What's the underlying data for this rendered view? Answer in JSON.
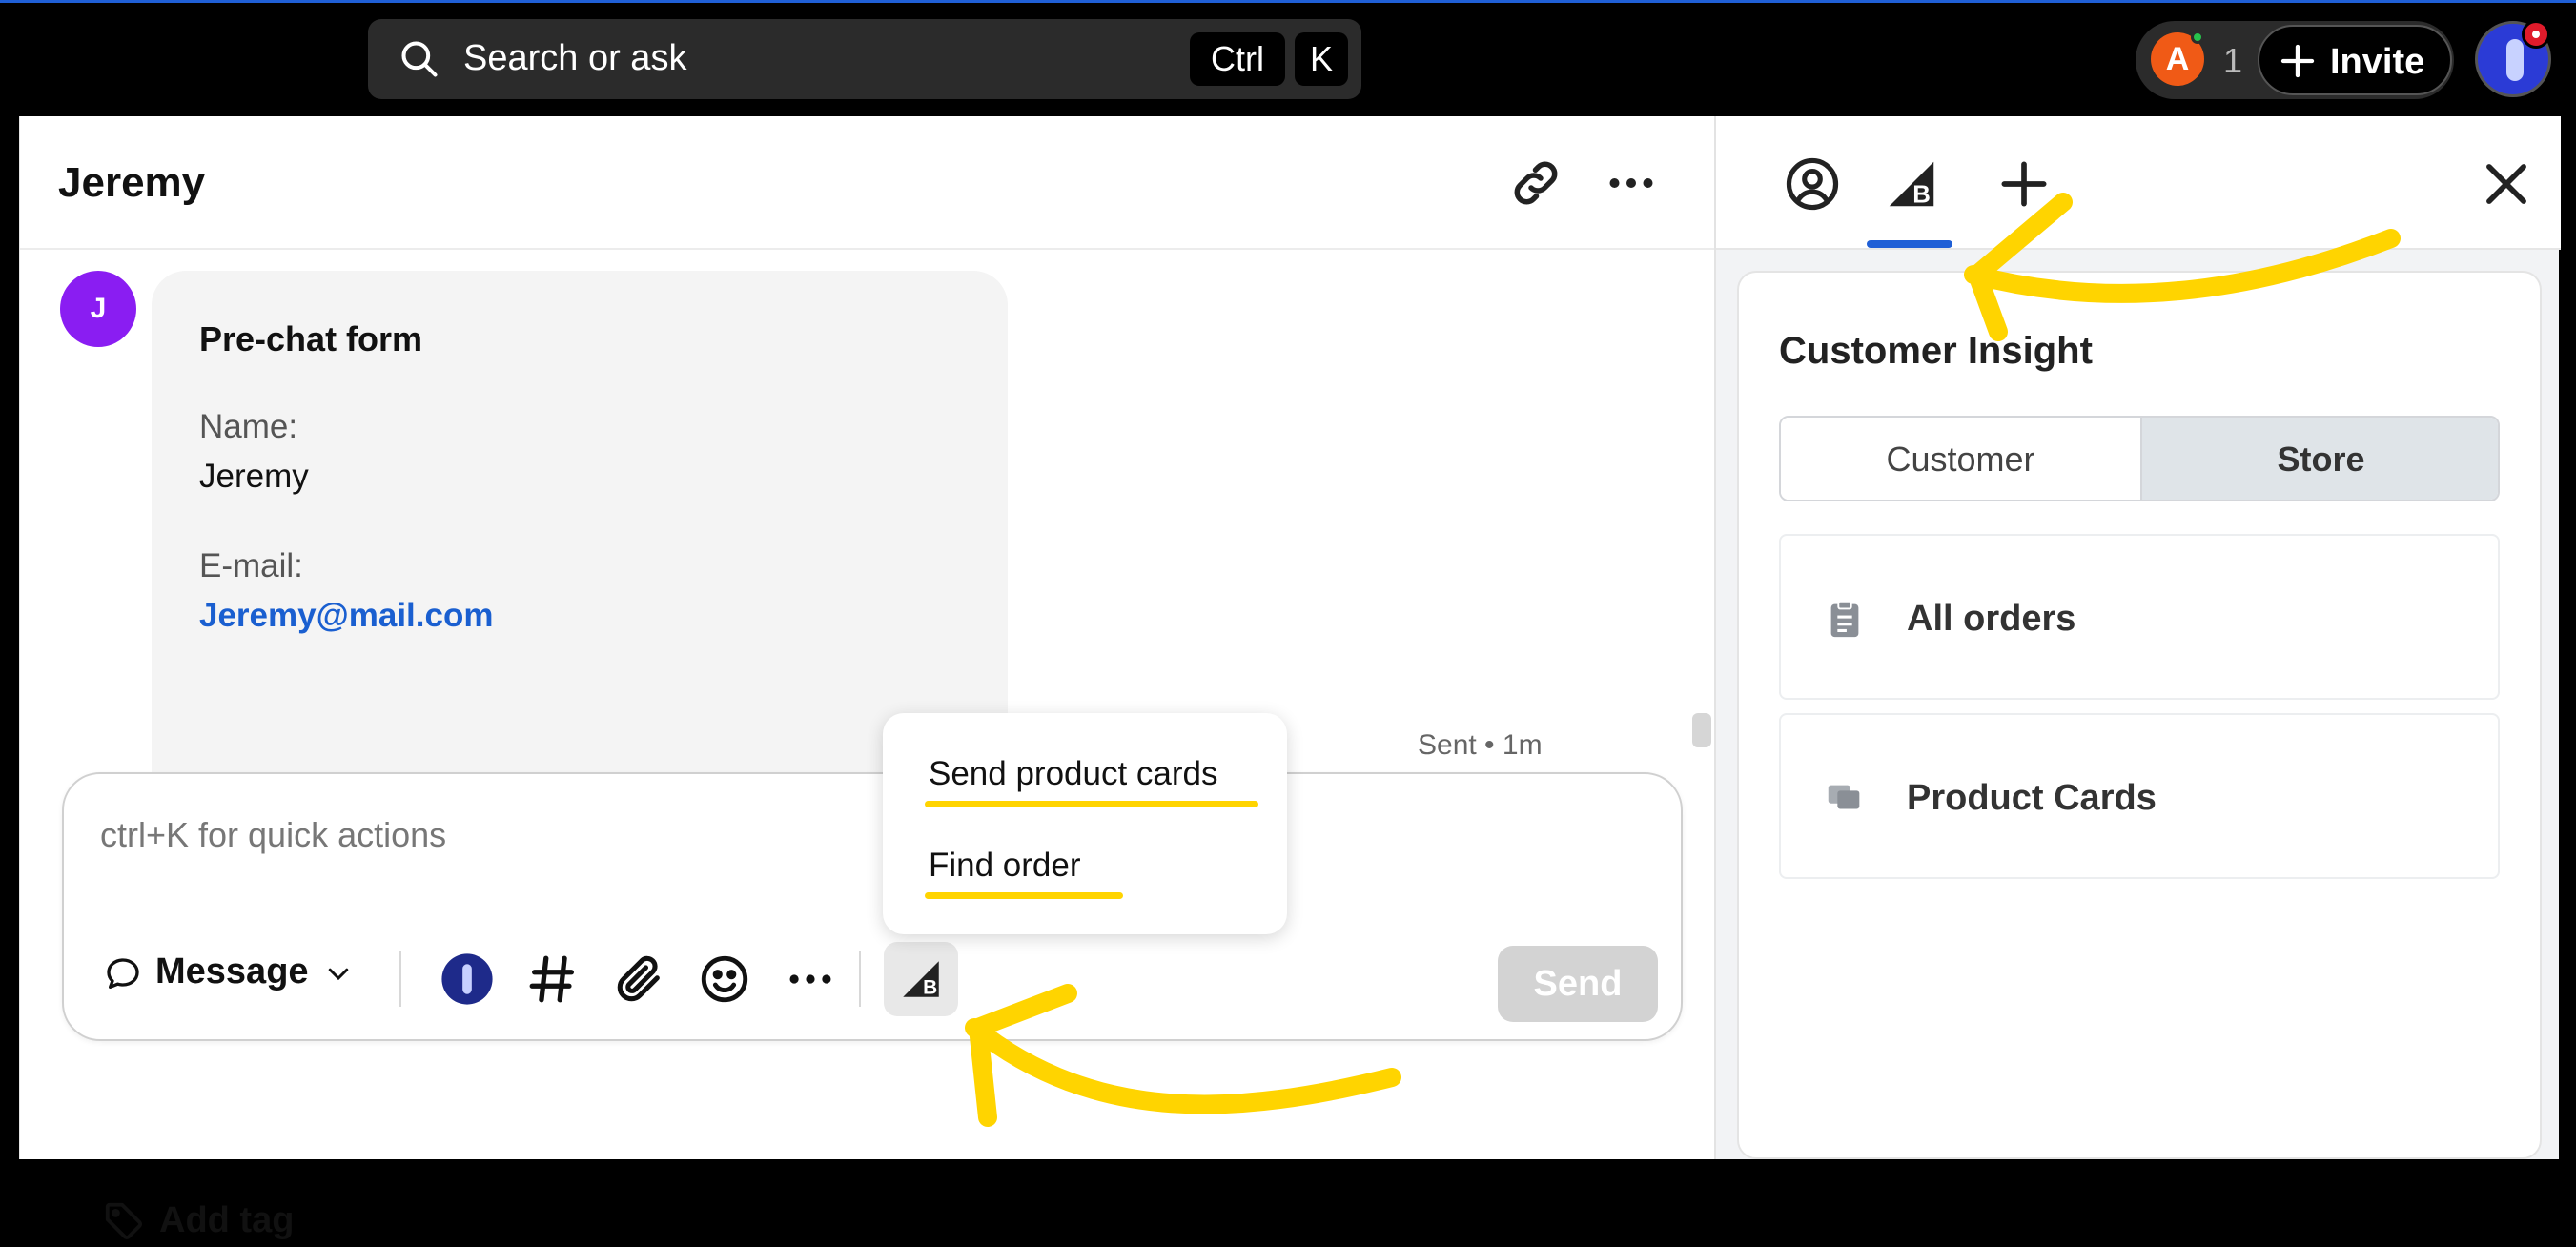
{
  "topbar": {
    "search_placeholder": "Search or ask",
    "shortcut_keys": [
      "Ctrl",
      "K"
    ],
    "presence_avatar": "A",
    "presence_count": "1",
    "invite_label": "Invite"
  },
  "conversation": {
    "contact_name": "Jeremy",
    "avatar_initial": "J",
    "prechat": {
      "title": "Pre-chat form",
      "name_label": "Name:",
      "name_value": "Jeremy",
      "email_label": "E-mail:",
      "email_value": "Jeremy@mail.com"
    },
    "status": "Sent • 1m"
  },
  "composer": {
    "placeholder": "ctrl+K for quick actions",
    "message_type": "Message",
    "send_label": "Send",
    "popup_items": [
      "Send product cards",
      "Find order"
    ],
    "add_tag_label": "Add tag"
  },
  "side_panel": {
    "title": "Customer Insight",
    "segments": [
      "Customer",
      "Store"
    ],
    "active_segment": "Store",
    "rows": [
      "All orders",
      "Product Cards"
    ]
  },
  "colors": {
    "accent_blue": "#1f5fd6",
    "highlight_yellow": "#ffd400",
    "avatar_purple": "#8a1df2",
    "presence_orange": "#f05a16",
    "email_link": "#1a5fd0"
  }
}
